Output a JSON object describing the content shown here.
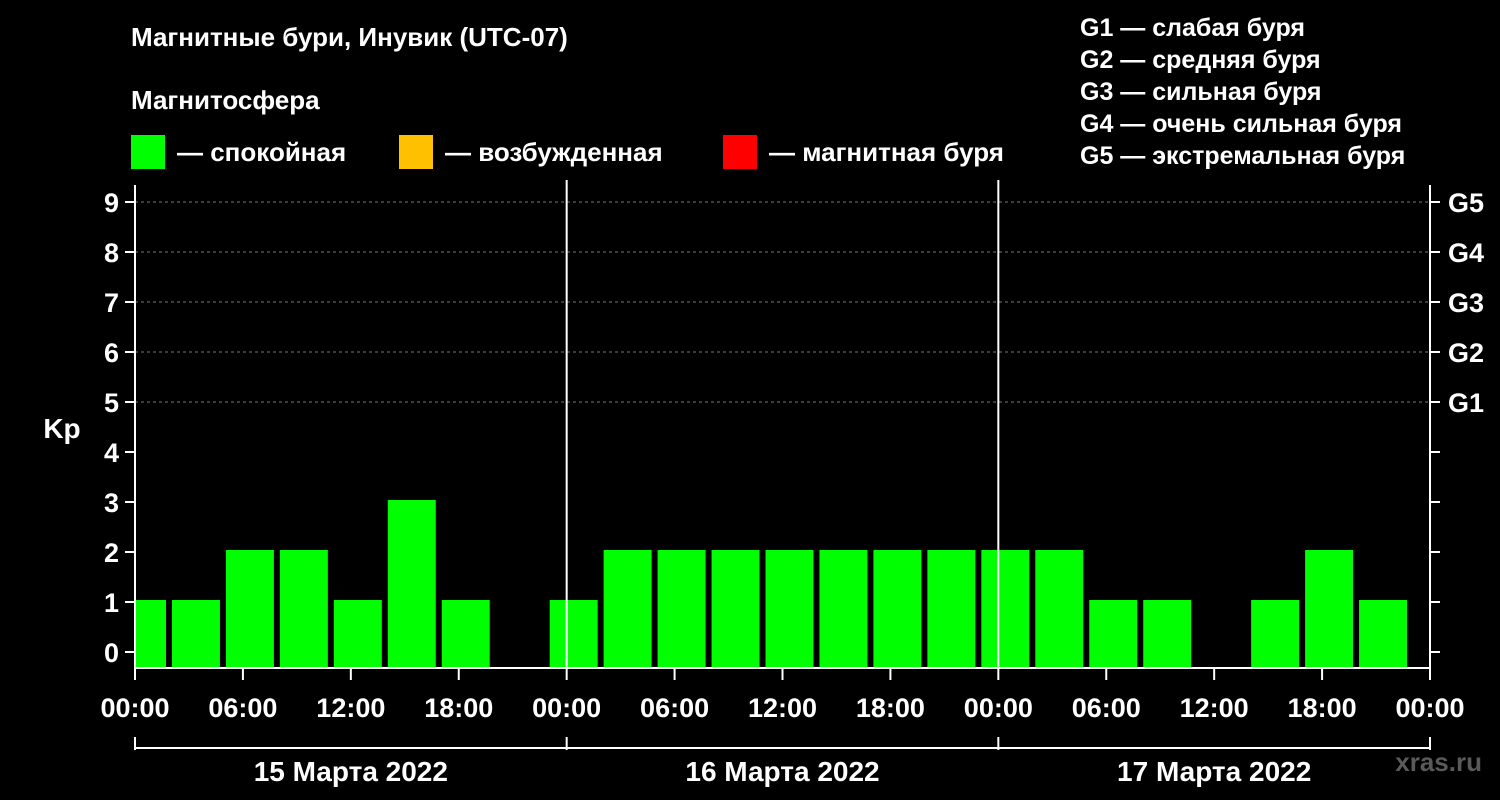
{
  "title": "Магнитные бури, Инувик (UTC-07)",
  "legend": {
    "heading": "Магнитосфера",
    "items": [
      {
        "label": "— спокойная",
        "color": "#00ff00"
      },
      {
        "label": "— возбужденная",
        "color": "#ffc000"
      },
      {
        "label": "— магнитная буря",
        "color": "#ff0000"
      }
    ]
  },
  "g_legend": [
    "G1 — слабая буря",
    "G2 — средняя буря",
    "G3 — сильная буря",
    "G4 — очень сильная буря",
    "G5 — экстремальная буря"
  ],
  "watermark": "xras.ru",
  "chart_data": {
    "type": "bar",
    "ylabel": "Kp",
    "ylim": [
      0,
      9
    ],
    "y_ticks": [
      0,
      1,
      2,
      3,
      4,
      5,
      6,
      7,
      8,
      9
    ],
    "g_ticks": [
      {
        "kp": 5,
        "label": "G1"
      },
      {
        "kp": 6,
        "label": "G2"
      },
      {
        "kp": 7,
        "label": "G3"
      },
      {
        "kp": 8,
        "label": "G4"
      },
      {
        "kp": 9,
        "label": "G5"
      }
    ],
    "x_tick_labels": [
      "00:00",
      "06:00",
      "12:00",
      "18:00",
      "00:00",
      "06:00",
      "12:00",
      "18:00",
      "00:00",
      "06:00",
      "12:00",
      "18:00",
      "00:00"
    ],
    "days": [
      "15 Марта 2022",
      "16 Марта 2022",
      "17 Марта 2022"
    ],
    "bar_color": "#00ff00",
    "series": [
      {
        "start_hour": 0,
        "end_hour": 2,
        "kp": 1
      },
      {
        "start_hour": 2,
        "end_hour": 5,
        "kp": 1
      },
      {
        "start_hour": 5,
        "end_hour": 8,
        "kp": 2
      },
      {
        "start_hour": 8,
        "end_hour": 11,
        "kp": 2
      },
      {
        "start_hour": 11,
        "end_hour": 14,
        "kp": 1
      },
      {
        "start_hour": 14,
        "end_hour": 17,
        "kp": 3
      },
      {
        "start_hour": 17,
        "end_hour": 20,
        "kp": 1
      },
      {
        "start_hour": 23,
        "end_hour": 26,
        "kp": 1
      },
      {
        "start_hour": 26,
        "end_hour": 29,
        "kp": 2
      },
      {
        "start_hour": 29,
        "end_hour": 32,
        "kp": 2
      },
      {
        "start_hour": 32,
        "end_hour": 35,
        "kp": 2
      },
      {
        "start_hour": 35,
        "end_hour": 38,
        "kp": 2
      },
      {
        "start_hour": 38,
        "end_hour": 41,
        "kp": 2
      },
      {
        "start_hour": 41,
        "end_hour": 44,
        "kp": 2
      },
      {
        "start_hour": 44,
        "end_hour": 47,
        "kp": 2
      },
      {
        "start_hour": 47,
        "end_hour": 50,
        "kp": 2
      },
      {
        "start_hour": 50,
        "end_hour": 53,
        "kp": 2
      },
      {
        "start_hour": 53,
        "end_hour": 56,
        "kp": 1
      },
      {
        "start_hour": 56,
        "end_hour": 59,
        "kp": 1
      },
      {
        "start_hour": 62,
        "end_hour": 65,
        "kp": 1
      },
      {
        "start_hour": 65,
        "end_hour": 68,
        "kp": 2
      },
      {
        "start_hour": 68,
        "end_hour": 71,
        "kp": 1
      }
    ]
  }
}
